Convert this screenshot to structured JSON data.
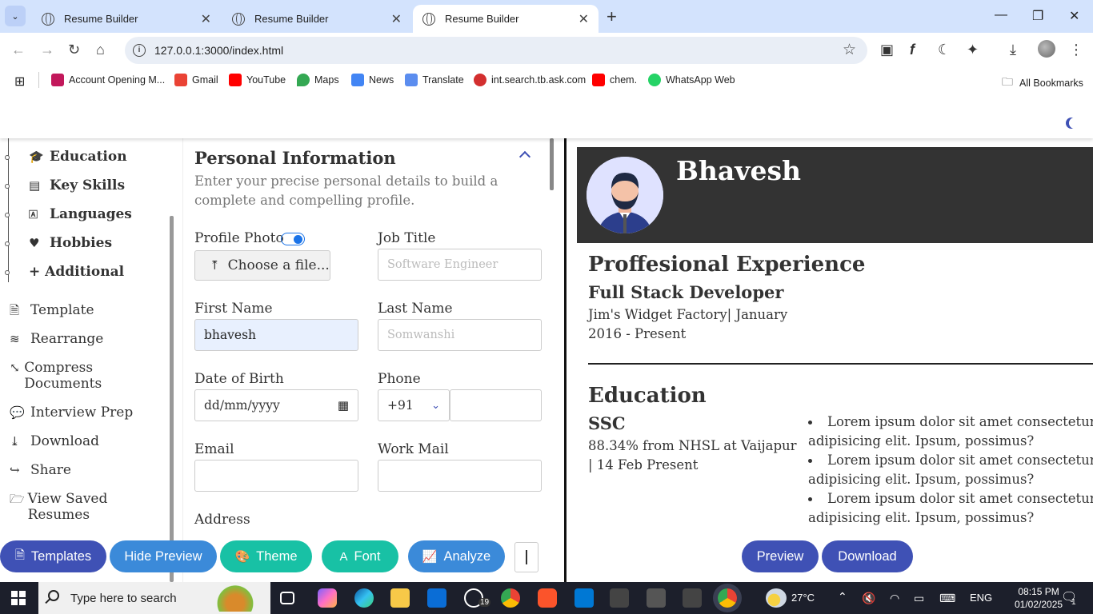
{
  "browser": {
    "tabs": [
      {
        "title": "Resume Builder",
        "active": false
      },
      {
        "title": "Resume Builder",
        "active": false
      },
      {
        "title": "Resume Builder",
        "active": true
      }
    ],
    "url": "127.0.0.1:3000/index.html",
    "bookmarks": [
      "Account Opening M...",
      "Gmail",
      "YouTube",
      "Maps",
      "News",
      "Translate",
      "int.search.tb.ask.com",
      "chem.",
      "WhatsApp Web"
    ],
    "all_bookmarks": "All Bookmarks"
  },
  "sidebar": {
    "sub_items": [
      {
        "label": "Education",
        "icon": "graduation-cap-icon"
      },
      {
        "label": "Key Skills",
        "icon": "list-icon"
      },
      {
        "label": "Languages",
        "icon": "language-icon"
      },
      {
        "label": "Hobbies",
        "icon": "heart-icon"
      },
      {
        "label": "+ Additional",
        "icon": ""
      }
    ],
    "menu": [
      {
        "label": "Template",
        "icon": "file-icon"
      },
      {
        "label": "Rearrange",
        "icon": "layers-icon"
      },
      {
        "label": "Compress Documents",
        "icon": "compress-icon"
      },
      {
        "label": "Interview Prep",
        "icon": "comments-icon"
      },
      {
        "label": "Download",
        "icon": "download-icon"
      },
      {
        "label": "Share",
        "icon": "share-icon"
      },
      {
        "label": "View Saved Resumes",
        "icon": "folder-icon"
      }
    ]
  },
  "form": {
    "title": "Personal Information",
    "description": "Enter your precise personal details to build a complete and compelling profile.",
    "profile_photo_label": "Profile Photo",
    "choose_file": "Choose a file...",
    "job_title_label": "Job Title",
    "job_title_placeholder": "Software Engineer",
    "first_name_label": "First Name",
    "first_name_value": "bhavesh",
    "last_name_label": "Last Name",
    "last_name_placeholder": "Somwanshi",
    "dob_label": "Date of Birth",
    "dob_placeholder": "dd/mm/yyyy",
    "phone_label": "Phone",
    "phone_code": "+91",
    "email_label": "Email",
    "work_mail_label": "Work Mail",
    "address_label": "Address"
  },
  "preview": {
    "name": "Bhavesh",
    "experience_heading": "Proffesional Experience",
    "job_role": "Full Stack Developer",
    "job_detail_1": "Jim's Widget Factory| January",
    "job_detail_2": "2016 - Present",
    "education_heading": "Education",
    "edu_title": "SSC",
    "edu_detail_1": "88.34% from NHSL at Vaijapur",
    "edu_detail_2": "| 14 Feb Present",
    "bullets": [
      "Lorem ipsum dolor sit amet consectetur adipisicing elit. Ipsum, possimus?",
      "Lorem ipsum dolor sit amet consectetur adipisicing elit. Ipsum, possimus?",
      "Lorem ipsum dolor sit amet consectetur adipisicing elit. Ipsum, possimus?"
    ]
  },
  "bottom": {
    "templates": "Templates",
    "hide_preview": "Hide Preview",
    "theme": "Theme",
    "font": "Font",
    "analyze": "Analyze",
    "preview": "Preview",
    "download": "Download"
  },
  "taskbar": {
    "search": "Type here to search",
    "whatsapp_badge": "19",
    "weather": "27°C",
    "lang": "ENG",
    "time": "08:15 PM",
    "date": "01/02/2025",
    "notif": "1"
  },
  "colors": {
    "indigo": "#3f51b5",
    "blue": "#3b8ad9",
    "teal": "#18c1a5",
    "dark": "#333333"
  }
}
